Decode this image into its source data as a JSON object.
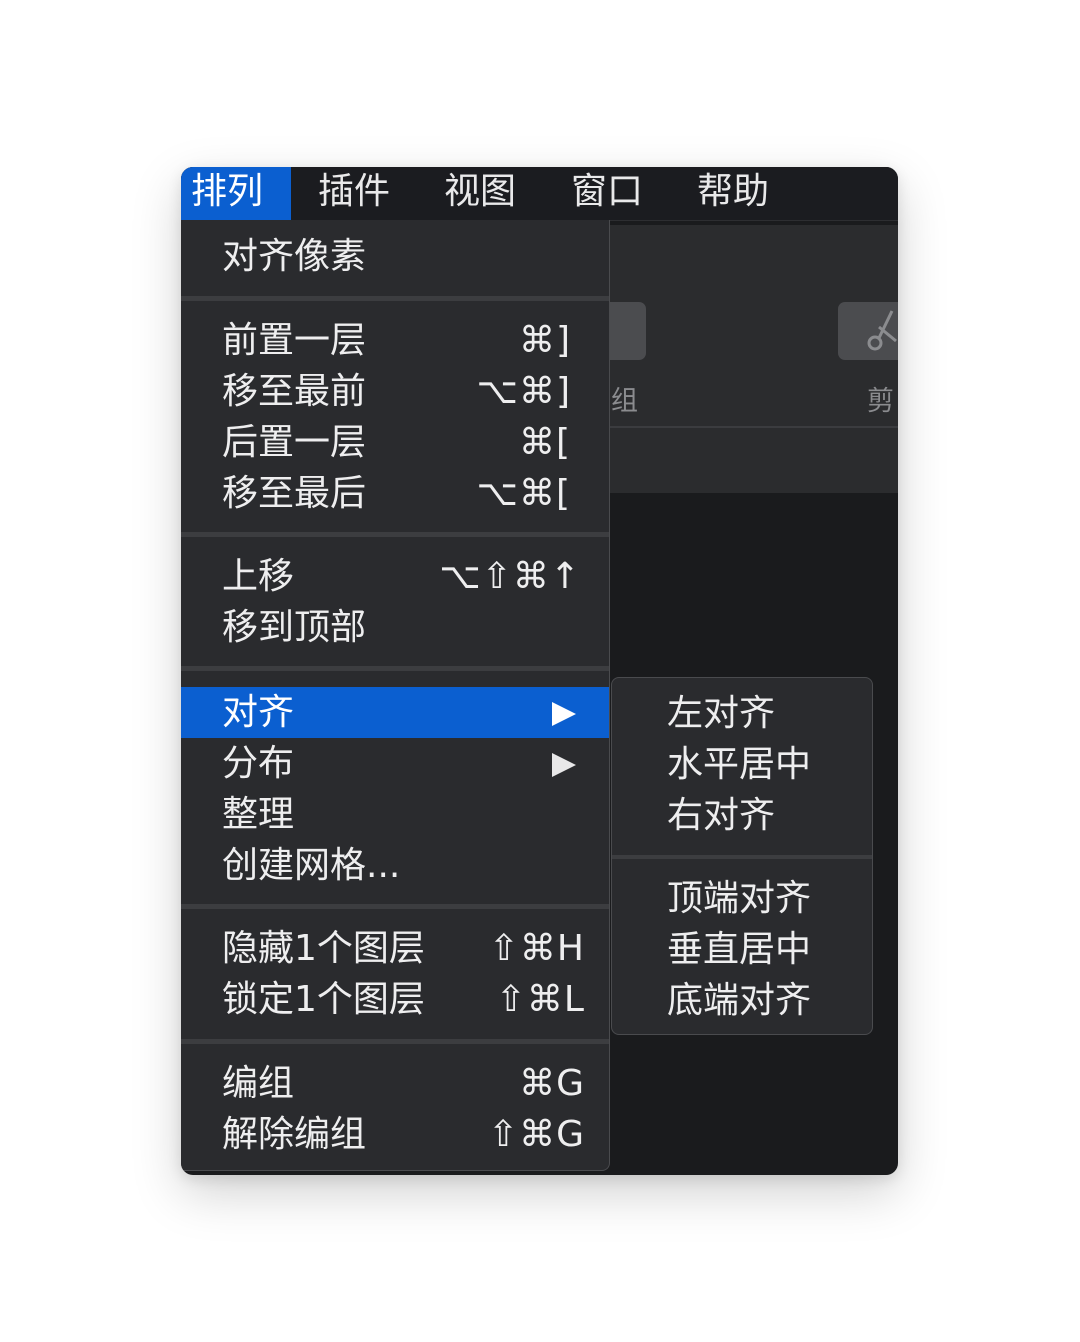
{
  "menubar": {
    "items": [
      {
        "label": "排列",
        "active": true
      },
      {
        "label": "插件"
      },
      {
        "label": "视图"
      },
      {
        "label": "窗口"
      },
      {
        "label": "帮助"
      }
    ]
  },
  "background_toolbar": {
    "group_label_partial": "组",
    "cut_label_partial": "剪",
    "cut_icon": "scissors-icon"
  },
  "arrange_menu": {
    "sections": [
      {
        "items": [
          {
            "label": "对齐像素",
            "shortcut": ""
          }
        ]
      },
      {
        "items": [
          {
            "label": "前置一层",
            "shortcut": "⌘]"
          },
          {
            "label": "移至最前",
            "shortcut": "⌥⌘]"
          },
          {
            "label": "后置一层",
            "shortcut": "⌘["
          },
          {
            "label": "移至最后",
            "shortcut": "⌥⌘["
          }
        ]
      },
      {
        "items": [
          {
            "label": "上移",
            "shortcut": "⌥⇧⌘↑"
          },
          {
            "label": "移到顶部",
            "shortcut": ""
          }
        ]
      },
      {
        "items": [
          {
            "label": "对齐",
            "submenu": true,
            "highlighted": true
          },
          {
            "label": "分布",
            "submenu": true
          },
          {
            "label": "整理",
            "shortcut": ""
          },
          {
            "label": "创建网格...",
            "shortcut": ""
          }
        ]
      },
      {
        "items": [
          {
            "label": "隐藏1个图层",
            "shortcut": "⇧⌘H"
          },
          {
            "label": "锁定1个图层",
            "shortcut": "⇧⌘L"
          }
        ]
      },
      {
        "items": [
          {
            "label": "编组",
            "shortcut": "⌘G"
          },
          {
            "label": "解除编组",
            "shortcut": "⇧⌘G"
          }
        ]
      }
    ]
  },
  "align_submenu": {
    "sections": [
      {
        "items": [
          {
            "label": "左对齐"
          },
          {
            "label": "水平居中"
          },
          {
            "label": "右对齐"
          }
        ]
      },
      {
        "items": [
          {
            "label": "顶端对齐"
          },
          {
            "label": "垂直居中"
          },
          {
            "label": "底端对齐"
          }
        ]
      }
    ]
  },
  "colors": {
    "highlight": "#0b5fd0",
    "menu_bg": "#2a2b2e",
    "menubar_bg": "#1b1c20"
  }
}
